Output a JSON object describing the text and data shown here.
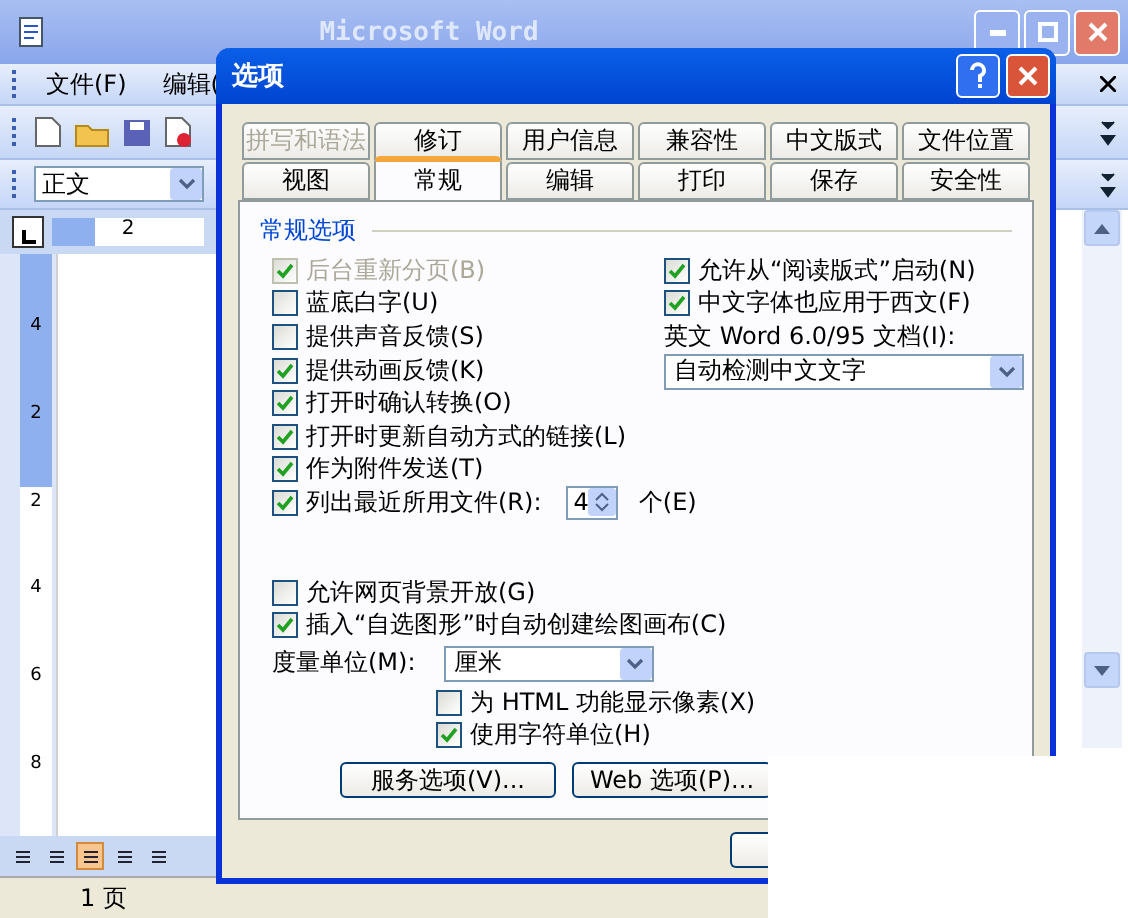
{
  "word": {
    "title": "Microsoft Word",
    "menu": [
      "文件(F)",
      "编辑("
    ],
    "style_box": {
      "value": "正文"
    },
    "ruler_label": "2",
    "vertical_ruler": [
      "4",
      "2",
      "2",
      "4",
      "6",
      "8"
    ],
    "view_buttons": [
      {
        "selected": false
      },
      {
        "selected": false
      },
      {
        "selected": true
      },
      {
        "selected": false
      },
      {
        "selected": false
      }
    ],
    "status_bar": [
      "1 页"
    ]
  },
  "dialog": {
    "title": "选项",
    "tab_rows": [
      [
        {
          "label": "拼写和语法",
          "selected": false,
          "disabled": true
        },
        {
          "label": "修订",
          "selected": false,
          "disabled": false
        },
        {
          "label": "用户信息",
          "selected": false,
          "disabled": false
        },
        {
          "label": "兼容性",
          "selected": false,
          "disabled": false
        },
        {
          "label": "中文版式",
          "selected": false,
          "disabled": false
        },
        {
          "label": "文件位置",
          "selected": false,
          "disabled": false
        }
      ],
      [
        {
          "label": "视图",
          "selected": false,
          "disabled": false
        },
        {
          "label": "常规",
          "selected": true,
          "disabled": false
        },
        {
          "label": "编辑",
          "selected": false,
          "disabled": false
        },
        {
          "label": "打印",
          "selected": false,
          "disabled": false
        },
        {
          "label": "保存",
          "selected": false,
          "disabled": false
        },
        {
          "label": "安全性",
          "selected": false,
          "disabled": false
        }
      ]
    ],
    "group_title": "常规选项",
    "left_options": [
      {
        "label": "后台重新分页(B)",
        "checked": true,
        "disabled": true
      },
      {
        "label": "蓝底白字(U)",
        "checked": false,
        "disabled": false
      },
      {
        "label": "提供声音反馈(S)",
        "checked": false,
        "disabled": false
      },
      {
        "label": "提供动画反馈(K)",
        "checked": true,
        "disabled": false
      },
      {
        "label": "打开时确认转换(O)",
        "checked": true,
        "disabled": false
      },
      {
        "label": "打开时更新自动方式的链接(L)",
        "checked": true,
        "disabled": false
      },
      {
        "label": "作为附件发送(T)",
        "checked": true,
        "disabled": false
      }
    ],
    "recent_files": {
      "label": "列出最近所用文件(R):",
      "checked": true,
      "value": "4",
      "unit": "个(E)"
    },
    "right_options": [
      {
        "label": "允许从“阅读版式”启动(N)",
        "checked": true,
        "disabled": false
      },
      {
        "label": "中文字体也应用于西文(F)",
        "checked": true,
        "disabled": false
      }
    ],
    "english_doc": {
      "label": "英文 Word 6.0/95 文档(I):",
      "value": "自动检测中文文字"
    },
    "lower_options": [
      {
        "label": "允许网页背景开放(G)",
        "checked": false,
        "disabled": false
      },
      {
        "label": "插入“自选图形”时自动创建绘图画布(C)",
        "checked": true,
        "disabled": false
      }
    ],
    "measure": {
      "label": "度量单位(M):",
      "value": "厘米"
    },
    "unit_options": [
      {
        "label": "为 HTML 功能显示像素(X)",
        "checked": false,
        "disabled": false
      },
      {
        "label": "使用字符单位(H)",
        "checked": true,
        "disabled": false
      }
    ],
    "buttons": [
      "服务选项(V)...",
      "Web 选项(P)..."
    ]
  }
}
